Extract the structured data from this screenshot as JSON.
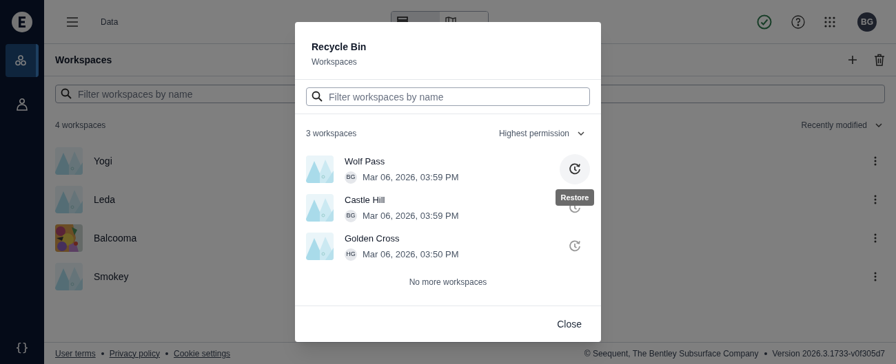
{
  "sidebar": {
    "items": [
      {
        "kind": "workspaces",
        "selected": true
      },
      {
        "kind": "account",
        "selected": false
      }
    ],
    "bottom_label": "{}"
  },
  "header": {
    "breadcrumb": "Data",
    "view_toggle": [
      {
        "kind": "list",
        "selected": true
      },
      {
        "kind": "map",
        "selected": false
      }
    ],
    "user_initials": "BG"
  },
  "workspaces": {
    "title": "Workspaces",
    "filter_placeholder": "Filter workspaces by name",
    "count": "4 workspaces",
    "sort": "Recently modified",
    "rows": [
      {
        "name": "Yogi",
        "kind": "placeholder"
      },
      {
        "name": "Leda",
        "kind": "placeholder"
      },
      {
        "name": "Balcooma",
        "kind": "picture"
      },
      {
        "name": "Smokey",
        "kind": "placeholder"
      }
    ]
  },
  "footer": {
    "links": [
      "User terms",
      "Privacy policy",
      "Cookie settings"
    ],
    "copyright": "© Seequent, The Bentley Subsurface Company",
    "version": "Version 2026.3.1733-v0f305d7"
  },
  "dialog": {
    "title": "Recycle Bin",
    "subtitle": "Workspaces",
    "filter_placeholder": "Filter workspaces by name",
    "count": "3 workspaces",
    "sort": "Highest permission",
    "items": [
      {
        "name": "Wolf Pass",
        "initials": "BG",
        "date": "Mar 06, 2026, 03:59 PM",
        "hovered": true
      },
      {
        "name": "Castle Hill",
        "initials": "BG",
        "date": "Mar 06, 2026, 03:59 PM",
        "hovered": false
      },
      {
        "name": "Golden Cross",
        "initials": "HG",
        "date": "Mar 06, 2026, 03:50 PM",
        "hovered": false
      }
    ],
    "tooltip": "Restore",
    "end_text": "No more workspaces",
    "close": "Close"
  }
}
